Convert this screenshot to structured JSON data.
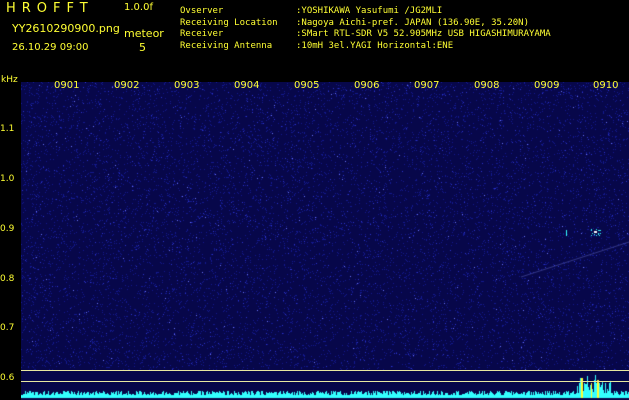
{
  "header": {
    "logo": "HROFFT",
    "version": "1.0.0f",
    "filename": "YY2610290900.png",
    "datetime": "26.10.29 09:00",
    "meteor_label": "meteor",
    "meteor_count": "5"
  },
  "info": [
    {
      "key": "Ovserver",
      "value": ":YOSHIKAWA Yasufumi /JG2MLI"
    },
    {
      "key": "Receiving Location",
      "value": ":Nagoya Aichi-pref. JAPAN (136.90E, 35.20N)"
    },
    {
      "key": "Receiver",
      "value": ":SMart RTL-SDR V5 52.905MHz USB HIGASHIMURAYAMA"
    },
    {
      "key": "Receiving Antenna",
      "value": ":10mH 3el.YAGI Horizontal:ENE"
    }
  ],
  "axis": {
    "unit": "kHz",
    "y_ticks": [
      "1.1",
      "1.0",
      "0.9",
      "0.8",
      "0.7",
      "0.6"
    ],
    "x_ticks": [
      "0901",
      "0902",
      "0903",
      "0904",
      "0905",
      "0906",
      "0907",
      "0908",
      "0909",
      "0910"
    ]
  },
  "colors": {
    "text": "#ffff33",
    "background": "#0a0a55",
    "signal": "#33ffff"
  }
}
